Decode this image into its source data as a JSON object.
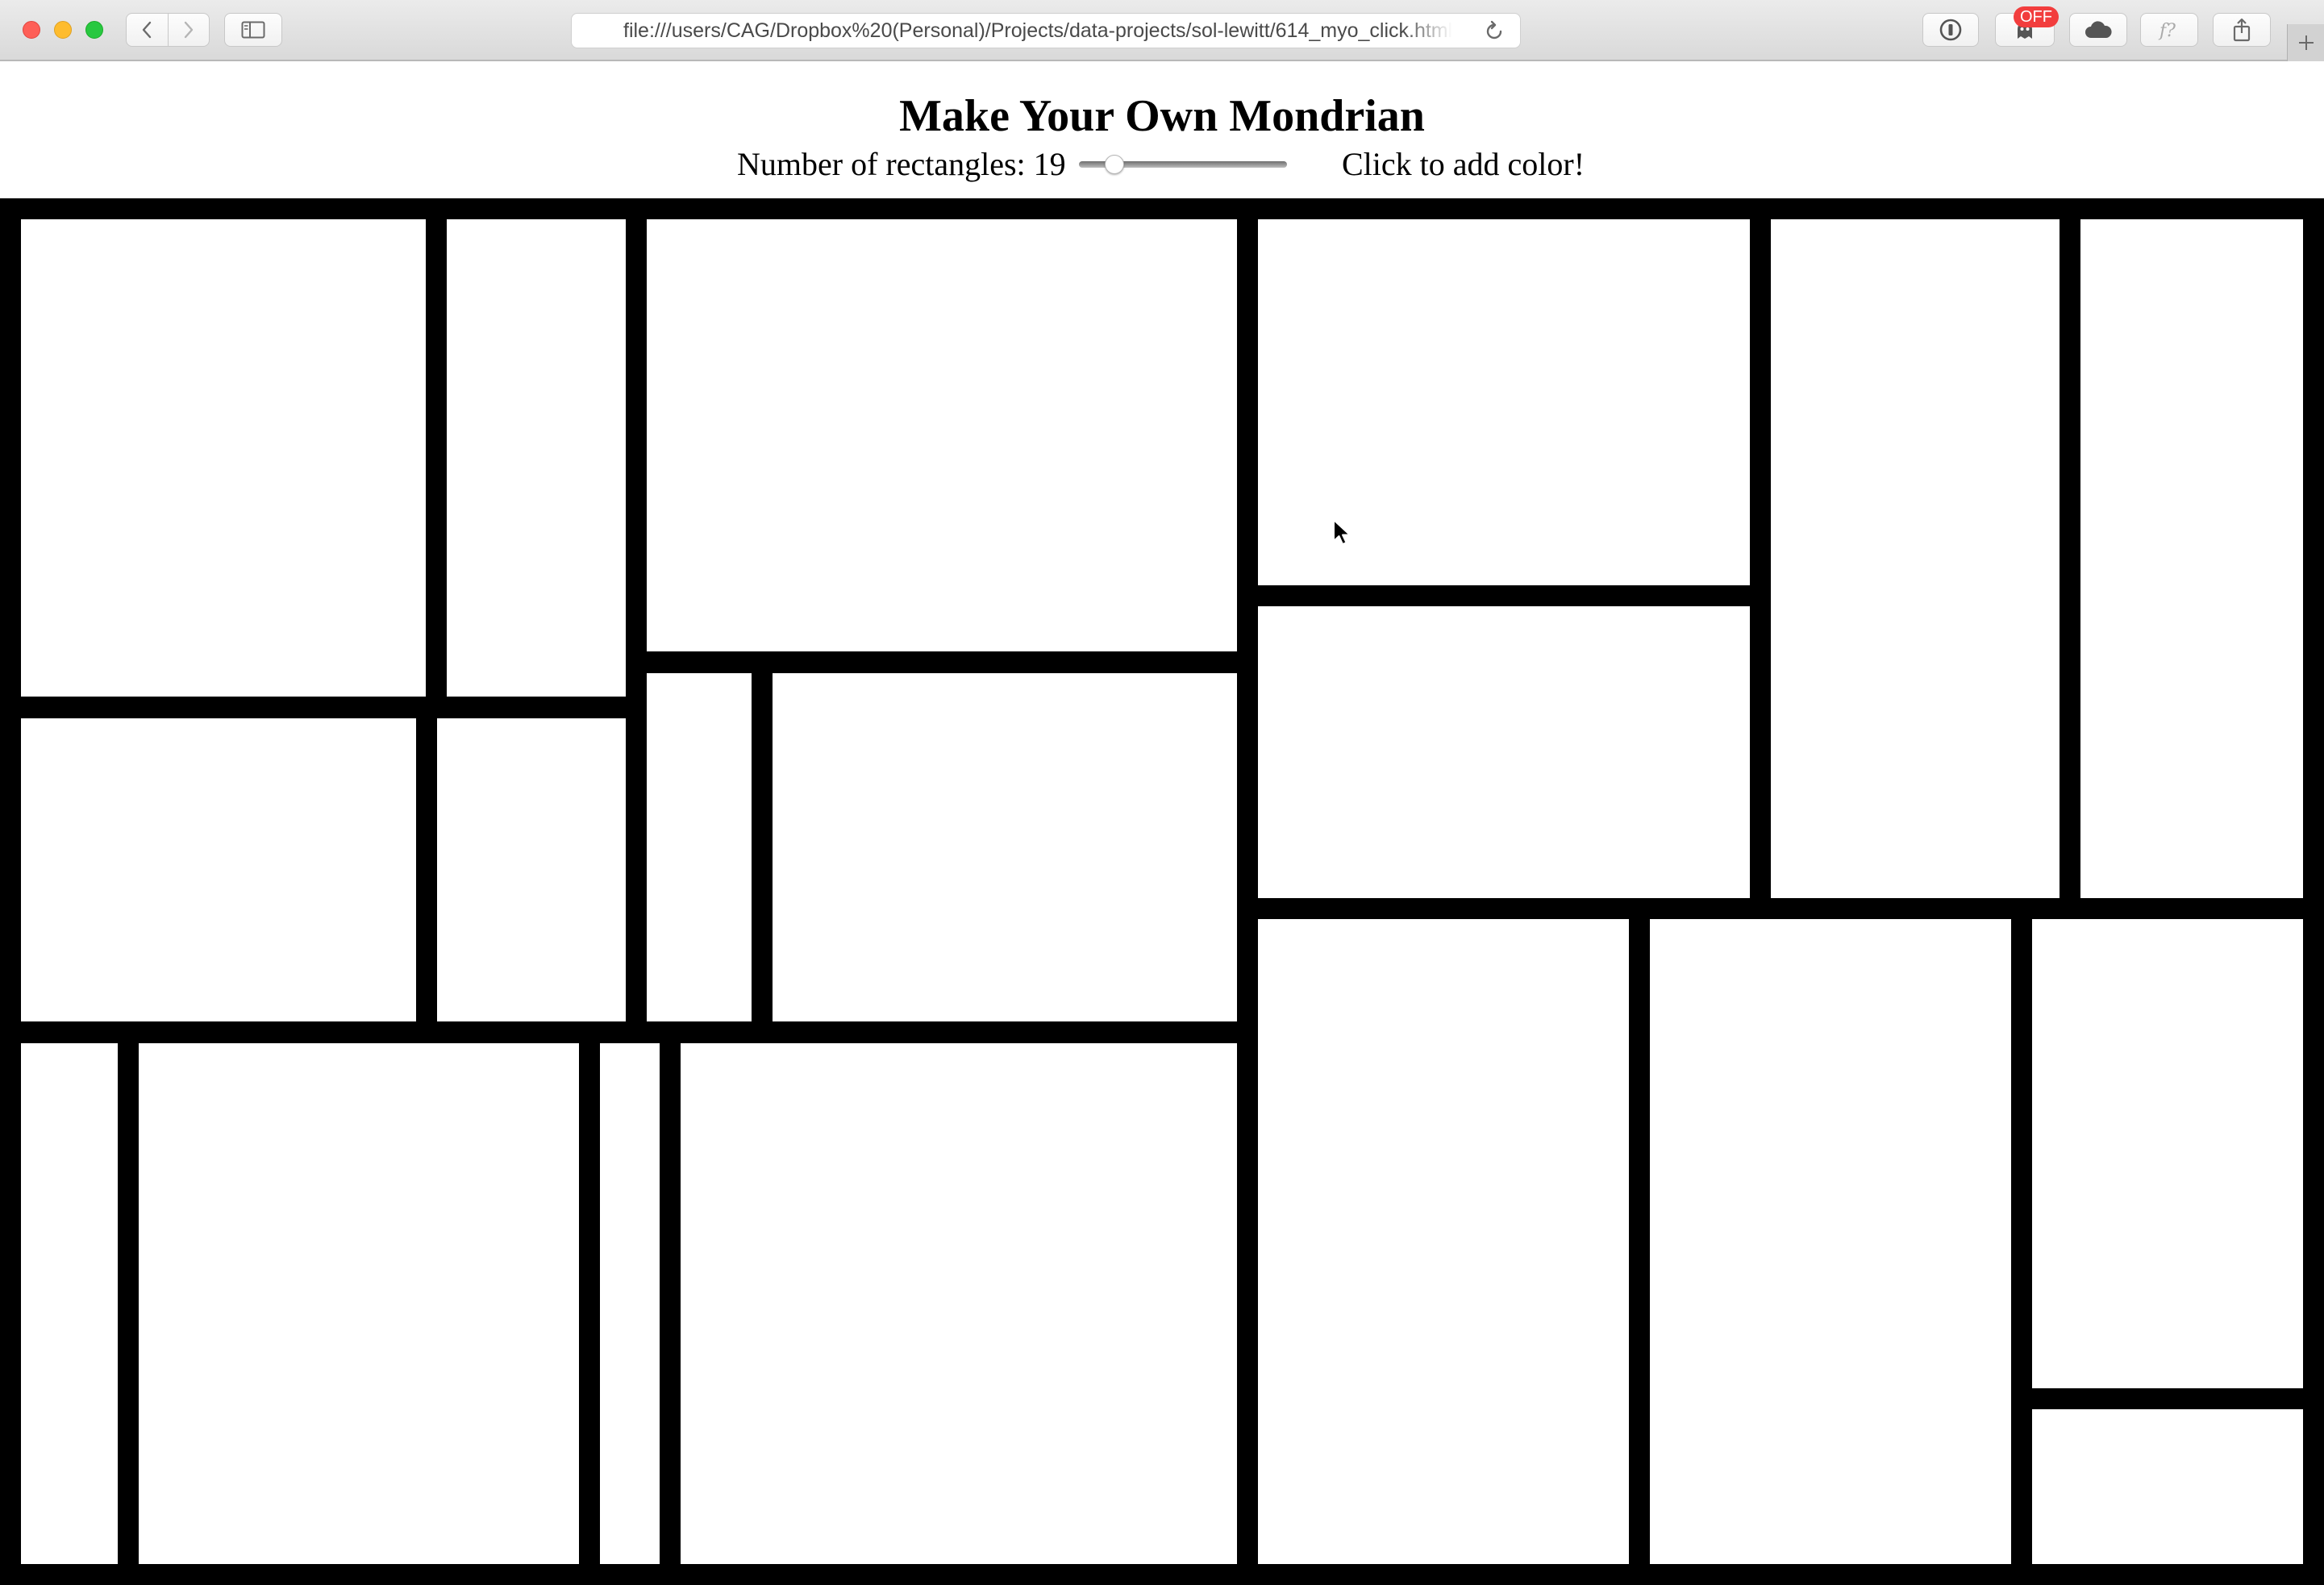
{
  "browser": {
    "url": "file:///users/CAG/Dropbox%20(Personal)/Projects/data-projects/sol-lewitt/614_myo_click.html",
    "extension_badge": "OFF"
  },
  "page": {
    "title": "Make Your Own Mondrian",
    "rect_count_label": "Number of rectangles: 19",
    "rect_count": 19,
    "instruction": "Click to add color!"
  },
  "colors": {
    "lines": "#000000",
    "fill": "#ffffff"
  }
}
